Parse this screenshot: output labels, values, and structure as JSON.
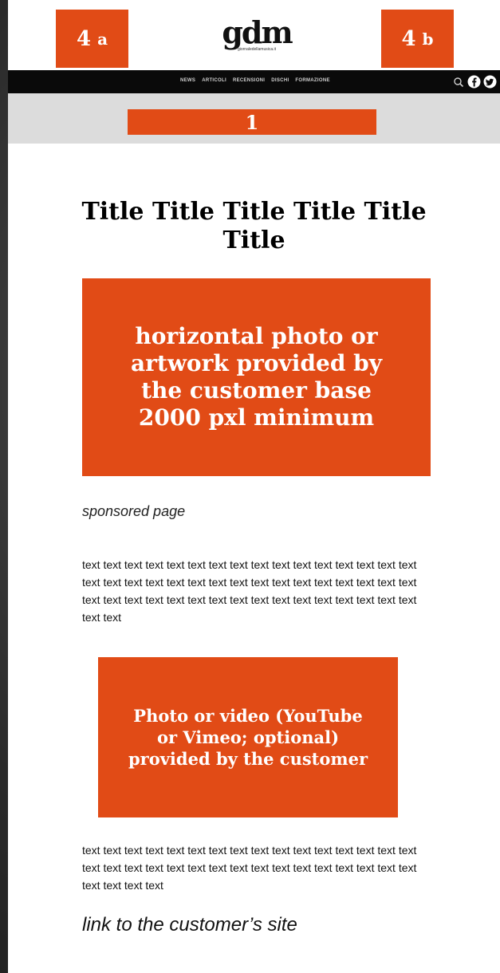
{
  "header": {
    "badge_a": {
      "num": "4",
      "letter": "a"
    },
    "badge_b": {
      "num": "4",
      "letter": "b"
    },
    "logo": {
      "word": "gdm",
      "subtitle": "giornaledellamusica.it"
    }
  },
  "nav": {
    "items": [
      "NEWS",
      "ARTICOLI",
      "RECENSIONI",
      "DISCHI",
      "FORMAZIONE"
    ],
    "icons": [
      "search-icon",
      "facebook-icon",
      "twitter-icon"
    ]
  },
  "banner": {
    "label": "1"
  },
  "article": {
    "title": "Title Title Title Title Title Title",
    "photo_placeholder": "horizontal photo or artwork provided by the customer base 2000 pxl minimum",
    "sponsored": "sponsored page",
    "paragraph_1": "text text text text text text text text text text text text text text text text text text text text text text text text text text text text text text text text text text text text text text text text text text text text text text text text text text",
    "video_placeholder": "Photo or video (YouTube or Vimeo; optional) provided by the customer",
    "paragraph_2": "text text text text text text text text text text text text text text text text text text text text text text text text text text text text text text text text text text text text",
    "link": "link to the customer’s site"
  },
  "colors": {
    "accent": "#e14b16",
    "navbar": "#0a0a0a",
    "banner_bar": "#dcdcdc"
  }
}
